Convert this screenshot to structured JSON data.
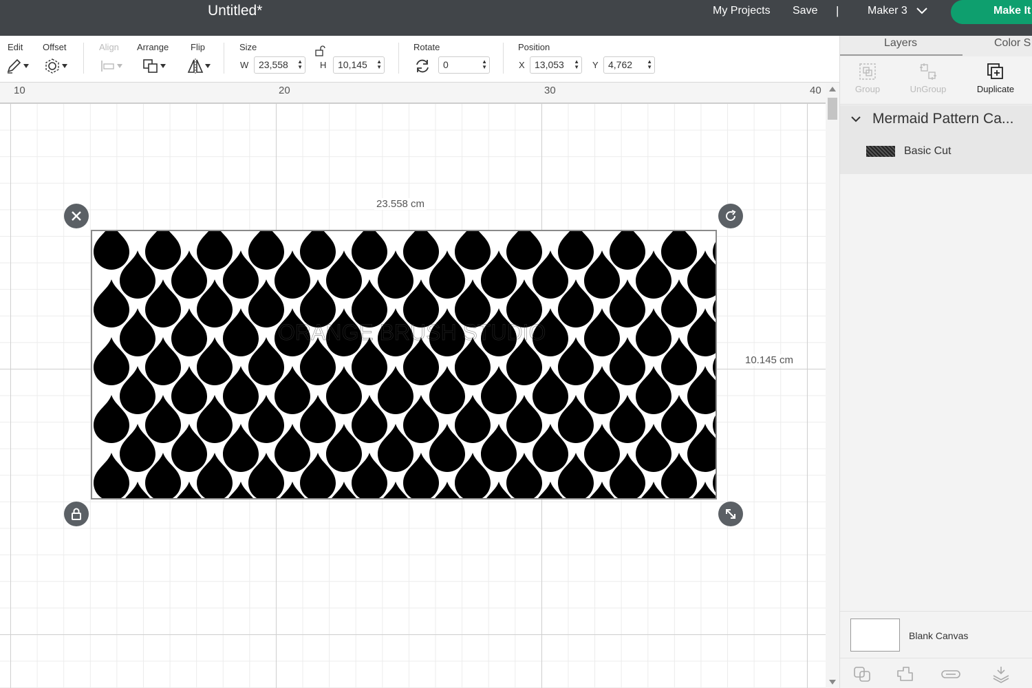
{
  "header": {
    "title": "Untitled*",
    "my_projects": "My Projects",
    "save": "Save",
    "separator": "|",
    "machine": "Maker 3",
    "make_it": "Make It"
  },
  "toolbar": {
    "edit": "Edit",
    "offset": "Offset",
    "align": "Align",
    "arrange": "Arrange",
    "flip": "Flip",
    "size": "Size",
    "w_label": "W",
    "w_value": "23,558",
    "h_label": "H",
    "h_value": "10,145",
    "rotate": "Rotate",
    "rotate_value": "0",
    "position": "Position",
    "x_label": "X",
    "x_value": "13,053",
    "y_label": "Y",
    "y_value": "4,762"
  },
  "ruler": {
    "ticks": [
      "10",
      "20",
      "30",
      "40"
    ]
  },
  "selection": {
    "width_label": "23.558 cm",
    "height_label": "10.145 cm",
    "watermark": "ORANGE BRUSH STUDIO"
  },
  "panel": {
    "tabs": [
      "Layers",
      "Color S"
    ],
    "tools": {
      "group": "Group",
      "ungroup": "UnGroup",
      "duplicate": "Duplicate"
    },
    "group_title": "Mermaid Pattern Ca...",
    "layer_name": "Basic Cut",
    "blank_canvas": "Blank Canvas"
  },
  "colors": {
    "header_bg": "#414549",
    "make_it_green": "#0e9f6e",
    "shape": "#000000"
  },
  "icons": [
    "pen-icon",
    "offset-icon",
    "align-icon",
    "arrange-icon",
    "flip-icon",
    "lock-icon",
    "rotate-icon",
    "close-icon",
    "resize-icon",
    "group-icon",
    "ungroup-icon",
    "duplicate-icon",
    "chevron-down-icon",
    "slice-icon",
    "combine-icon",
    "attach-icon",
    "flatten-icon"
  ]
}
